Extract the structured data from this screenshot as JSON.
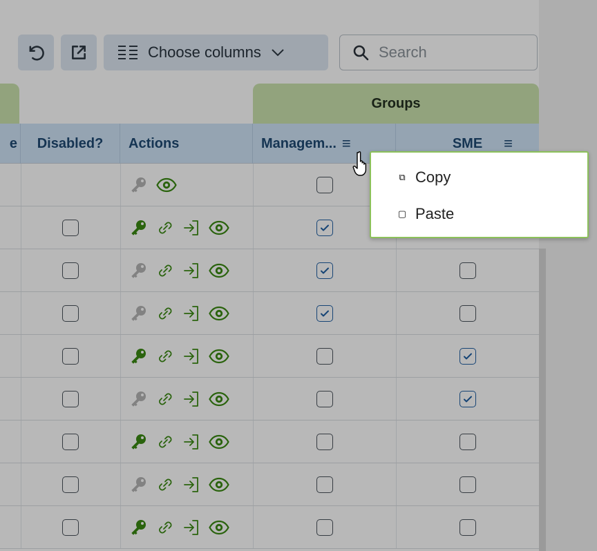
{
  "toolbar": {
    "undo_icon": "undo-icon",
    "export_icon": "open-external-icon",
    "choose_columns_label": "Choose columns",
    "search_placeholder": "Search"
  },
  "table": {
    "group_header": "Groups",
    "columns": {
      "partial": "e",
      "disabled": "Disabled?",
      "actions": "Actions",
      "management": "Managem...",
      "sme": "SME"
    },
    "rows": [
      {
        "disabled": null,
        "key_active": false,
        "show_link": false,
        "show_login": false,
        "management": false,
        "sme": null
      },
      {
        "disabled": false,
        "key_active": true,
        "show_link": true,
        "show_login": true,
        "management": true,
        "sme": null
      },
      {
        "disabled": false,
        "key_active": false,
        "show_link": true,
        "show_login": true,
        "management": true,
        "sme": false
      },
      {
        "disabled": false,
        "key_active": false,
        "show_link": true,
        "show_login": true,
        "management": true,
        "sme": false
      },
      {
        "disabled": false,
        "key_active": true,
        "show_link": true,
        "show_login": true,
        "management": false,
        "sme": true
      },
      {
        "disabled": false,
        "key_active": false,
        "show_link": true,
        "show_login": true,
        "management": false,
        "sme": true
      },
      {
        "disabled": false,
        "key_active": true,
        "show_link": true,
        "show_login": true,
        "management": false,
        "sme": false
      },
      {
        "disabled": false,
        "key_active": false,
        "show_link": true,
        "show_login": true,
        "management": false,
        "sme": false
      },
      {
        "disabled": false,
        "key_active": true,
        "show_link": true,
        "show_login": true,
        "management": false,
        "sme": false
      }
    ]
  },
  "context_menu": {
    "copy_label": "Copy",
    "paste_label": "Paste"
  },
  "colors": {
    "group_header_bg": "#cbe2ae",
    "column_header_bg": "#cfe4f7",
    "action_green": "#3b8a13",
    "key_inactive": "#b4b4b4",
    "checkbox_checked": "#1f5fa3",
    "menu_border": "#8cc15a"
  }
}
